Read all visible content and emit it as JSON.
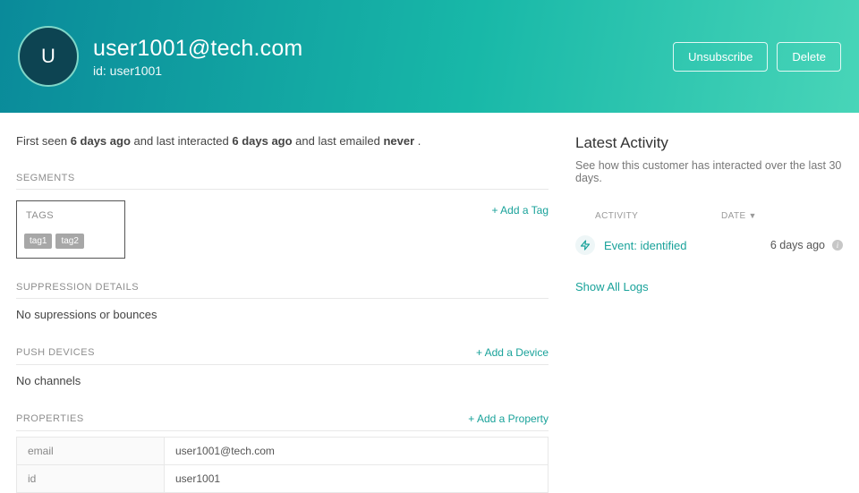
{
  "header": {
    "avatar_letter": "U",
    "title": "user1001@tech.com",
    "subtitle": "id: user1001",
    "unsubscribe_label": "Unsubscribe",
    "delete_label": "Delete"
  },
  "overview": {
    "prefix": "First seen ",
    "first_seen": "6 days ago",
    "mid1": " and last interacted ",
    "last_interacted": "6 days ago",
    "mid2": " and last emailed ",
    "last_emailed": "never",
    "suffix": " ."
  },
  "segments": {
    "heading": "SEGMENTS"
  },
  "tags": {
    "heading": "TAGS",
    "add_label": "+ Add a Tag",
    "items": [
      "tag1",
      "tag2"
    ]
  },
  "suppression": {
    "heading": "SUPPRESSION DETAILS",
    "body": "No supressions or bounces"
  },
  "push": {
    "heading": "PUSH DEVICES",
    "add_label": "+ Add a Device",
    "body": "No channels"
  },
  "properties": {
    "heading": "PROPERTIES",
    "add_label": "+ Add a Property",
    "rows": [
      {
        "key": "email",
        "value": "user1001@tech.com"
      },
      {
        "key": "id",
        "value": "user1001"
      }
    ]
  },
  "latest": {
    "title": "Latest Activity",
    "subtitle": "See how this customer has interacted over the last 30 days.",
    "col_activity": "ACTIVITY",
    "col_date": "DATE",
    "row": {
      "label": "Event: identified",
      "date": "6 days ago"
    },
    "show_all": "Show All Logs"
  }
}
